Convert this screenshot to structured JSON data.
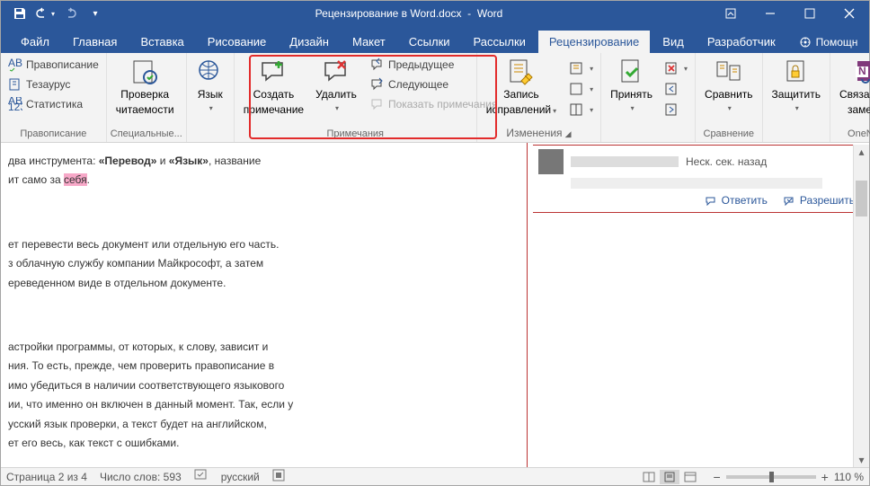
{
  "title_doc": "Рецензирование в Word.docx",
  "title_app": "Word",
  "tabs": {
    "file": "Файл",
    "home": "Главная",
    "insert": "Вставка",
    "drawing": "Рисование",
    "design": "Дизайн",
    "layout": "Макет",
    "references": "Ссылки",
    "mailings": "Рассылки",
    "review": "Рецензирование",
    "view": "Вид",
    "developer": "Разработчик",
    "help": "Помощн"
  },
  "ribbon": {
    "proofing": {
      "spelling": "Правописание",
      "thesaurus": "Тезаурус",
      "stats": "Статистика",
      "label": "Правописание"
    },
    "accessibility": {
      "btn1": "Проверка",
      "btn2": "читаемости",
      "label": "Специальные..."
    },
    "language": {
      "btn": "Язык",
      "label": ""
    },
    "comments": {
      "new": "Создать",
      "new2": "примечание",
      "delete": "Удалить",
      "prev": "Предыдущее",
      "next": "Следующее",
      "show": "Показать примечания",
      "label": "Примечания"
    },
    "tracking": {
      "track1": "Запись",
      "track2": "исправлений",
      "label": "Изменения"
    },
    "changes": {
      "accept": "Принять",
      "label": ""
    },
    "compare": {
      "btn": "Сравнить",
      "label": "Сравнение"
    },
    "protect": {
      "btn": "Защитить",
      "label": ""
    },
    "onenote": {
      "btn1": "Связанные",
      "btn2": "заметки",
      "label": "OneNote"
    }
  },
  "document": {
    "line1a": "два инструмента: ",
    "line1b": "«Перевод»",
    "line1c": " и ",
    "line1d": "«Язык»",
    "line1e": ", название",
    "line2a": "ит само за ",
    "line2b": "себя",
    "line2c": ".",
    "para2_l1": "ет перевести весь документ или отдельную его часть.",
    "para2_l2": "з облачную службу компании Майкрософт, а затем",
    "para2_l3": "ереведенном виде в отдельном документе.",
    "para3_l1": "астройки программы, от которых, к слову, зависит и",
    "para3_l2": "ния. То есть, прежде, чем проверить правописание в",
    "para3_l3": "имо убедиться в наличии соответствующего языкового",
    "para3_l4": "ии, что именно он включен в данный момент. Так, если у",
    "para3_l5": "усский язык проверки, а текст будет на английском,",
    "para3_l6": "ет его весь, как текст с ошибками."
  },
  "comment": {
    "time": "Неск. сек. назад",
    "reply": "Ответить",
    "resolve": "Разрешить"
  },
  "status": {
    "page": "Страница 2 из 4",
    "words": "Число слов: 593",
    "lang": "русский",
    "zoom": "110 %"
  }
}
